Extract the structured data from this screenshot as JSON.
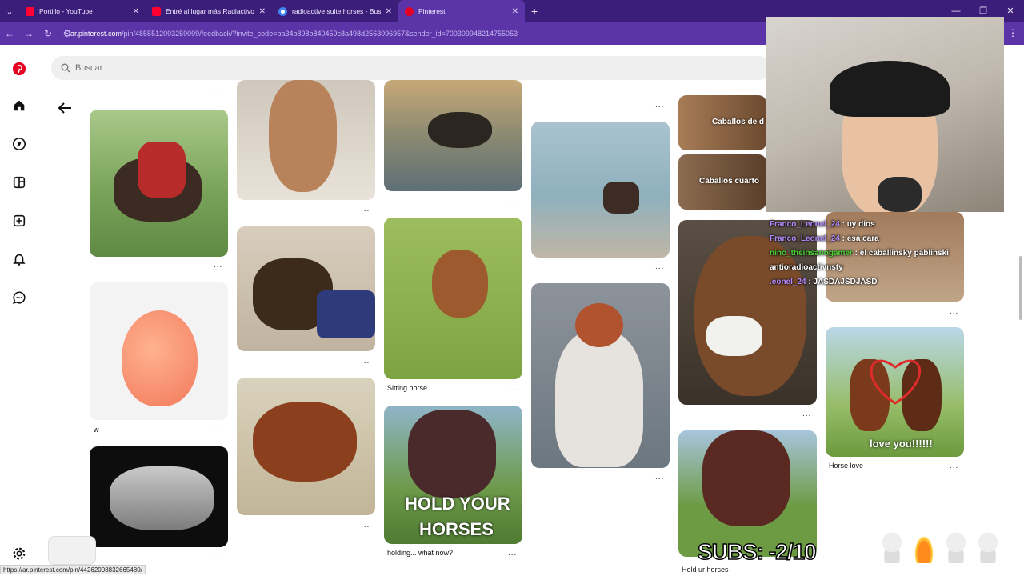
{
  "browser": {
    "tabs": [
      {
        "title": "Portillo - YouTube",
        "favicon": "youtube-icon"
      },
      {
        "title": "Entré al lugar más Radiactivo d",
        "favicon": "youtube-icon"
      },
      {
        "title": "radioactive suite horses - Busca",
        "favicon": "google-icon"
      },
      {
        "title": "Pinterest",
        "favicon": "pinterest-icon",
        "active": true
      }
    ],
    "url_host": "ar.pinterest.com",
    "url_path": "/pin/485551209325909​9/feedback/?invite_code=ba34b898b840459c8a498d2563096957&sender_id=700309948214755053",
    "status_url": "https://ar.pinterest.com/pin/442620088326654​80/"
  },
  "search": {
    "placeholder": "Buscar"
  },
  "pins": {
    "captions": {
      "w": "w",
      "sitting": "Sitting horse",
      "holding": "holding... what now?",
      "horse_love": "Horse love",
      "hold_ur": "Hold ur horses"
    },
    "overlay_texts": {
      "hold_your": "HOLD YOUR",
      "horses": "HORSES",
      "caballos_de": "Caballos de d",
      "caballos_cuarto": "Caballos cuarto",
      "love_you": "love you!!!!!!"
    },
    "more_label": "..."
  },
  "stream": {
    "chat": [
      {
        "user": "Franco_Leonel_24",
        "text": " : uy dios"
      },
      {
        "user": "Franco_Leonel_24",
        "text": " : esa cara"
      },
      {
        "user": "nino_theinsanogamer",
        "text": " : el caballinsky pablinski antioradioactivnsty"
      },
      {
        "user": ".eonel_24",
        "text": " : JASDAJSDJASD"
      }
    ],
    "subs_label": "SUBS: -2/10"
  },
  "colors": {
    "tab_bar": "#3a1e7a",
    "address_bar": "#5b35a8",
    "pinterest_red": "#e60023"
  }
}
